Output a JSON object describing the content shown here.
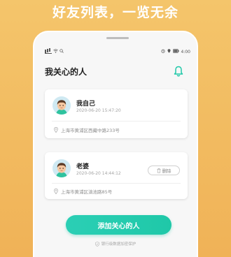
{
  "headline": "好友列表，一览无余",
  "status_bar": {
    "time": "4:00"
  },
  "page_title": "我关心的人",
  "contacts": [
    {
      "name": "我自己",
      "time": "2020-06-20 15:47:20",
      "address": "上海市黄浦区西藏中路233号"
    },
    {
      "name": "老婆",
      "time": "2020-06-20 14:44:12",
      "address": "上海市黄浦区滇池路85号",
      "delete_label": "删除"
    }
  ],
  "add_button_label": "添加关心的人",
  "privacy_note": "银行级数据加密保护",
  "colors": {
    "accent": "#1fc8a8",
    "background": "#f2b95f"
  }
}
